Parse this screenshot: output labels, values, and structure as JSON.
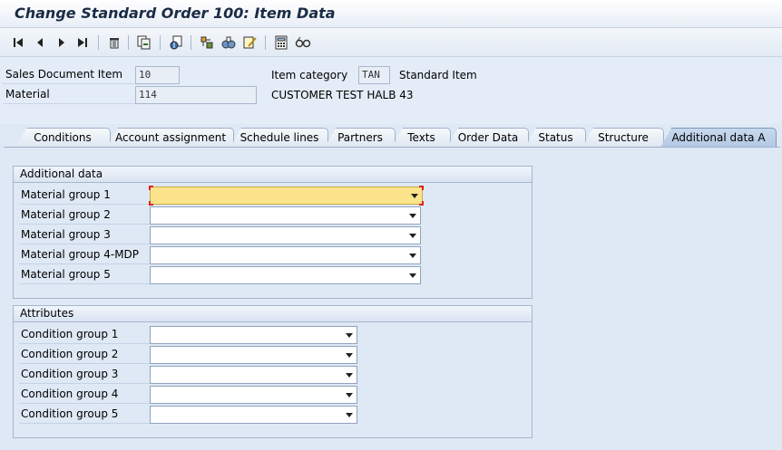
{
  "window": {
    "title": "Change Standard Order 100: Item Data"
  },
  "toolbar": {
    "buttons": [
      "first-page-icon",
      "previous-page-icon",
      "next-page-icon",
      "last-page-icon",
      "delete-icon",
      "copy-icon",
      "document-flow-icon",
      "configuration-icon",
      "variant-icon",
      "edit-icon",
      "calculator-icon",
      "glasses-icon"
    ]
  },
  "header": {
    "sales_doc_item_label": "Sales Document Item",
    "sales_doc_item_value": "10",
    "material_label": "Material",
    "material_value": "114",
    "item_category_label": "Item category",
    "item_category_value": "TAN",
    "item_category_desc": "Standard Item",
    "material_desc": "CUSTOMER TEST HALB 43"
  },
  "tabs": [
    {
      "label": "Conditions"
    },
    {
      "label": "Account assignment"
    },
    {
      "label": "Schedule lines"
    },
    {
      "label": "Partners"
    },
    {
      "label": "Texts"
    },
    {
      "label": "Order Data"
    },
    {
      "label": "Status"
    },
    {
      "label": "Structure"
    },
    {
      "label": "Additional data A"
    }
  ],
  "additional_data": {
    "title": "Additional data",
    "rows": [
      {
        "label": "Material group 1",
        "value": ""
      },
      {
        "label": "Material group 2",
        "value": ""
      },
      {
        "label": "Material group 3",
        "value": ""
      },
      {
        "label": "Material group 4-MDP",
        "value": ""
      },
      {
        "label": "Material group 5",
        "value": ""
      }
    ]
  },
  "attributes": {
    "title": "Attributes",
    "rows": [
      {
        "label": "Condition group 1",
        "value": ""
      },
      {
        "label": "Condition group 2",
        "value": ""
      },
      {
        "label": "Condition group 3",
        "value": ""
      },
      {
        "label": "Condition group 4",
        "value": ""
      },
      {
        "label": "Condition group 5",
        "value": ""
      }
    ]
  }
}
